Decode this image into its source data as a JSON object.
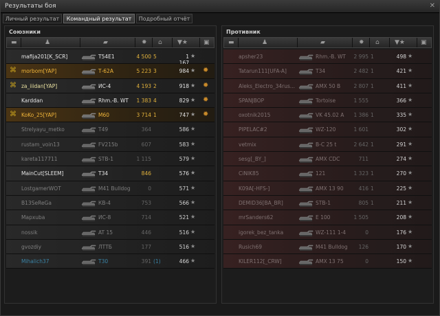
{
  "window": {
    "title": "Результаты боя",
    "close": "✕"
  },
  "tabs": [
    "Личный результат",
    "Командный результат",
    "Подробный отчёт"
  ],
  "allies": {
    "title": "Союзники",
    "rows": [
      {
        "player": "mafija201[K_SCR]",
        "tank": "T54E1",
        "dmg": "4 500",
        "kills": "5",
        "xp": "1 167",
        "alive": true,
        "medal": false,
        "ach": false
      },
      {
        "player": "morbom[YAP]",
        "tank": "Т-62А",
        "dmg": "5 223",
        "kills": "3",
        "xp": "984",
        "alive": true,
        "medal": true,
        "ach": true,
        "me": true
      },
      {
        "player": "za_iiidan[YAP]",
        "tank": "ИС-4",
        "dmg": "4 193",
        "kills": "2",
        "xp": "918",
        "alive": true,
        "medal": true,
        "ach": true,
        "platoon": true
      },
      {
        "player": "Karddan",
        "tank": "Rhm.-B. WT",
        "dmg": "1 383",
        "kills": "4",
        "xp": "829",
        "alive": true,
        "medal": false,
        "ach": true
      },
      {
        "player": "KoKo_25[YAP]",
        "tank": "M60",
        "dmg": "3 714",
        "kills": "1",
        "xp": "747",
        "alive": true,
        "medal": true,
        "ach": true,
        "me": true
      },
      {
        "player": "Strelyayu_metko",
        "tank": "T49",
        "dmg": "364",
        "kills": "",
        "xp": "586",
        "alive": false
      },
      {
        "player": "rustam_voin13",
        "tank": "FV215b",
        "dmg": "607",
        "kills": "",
        "xp": "583",
        "alive": false
      },
      {
        "player": "kareta117711",
        "tank": "STB-1",
        "dmg": "1 115",
        "kills": "",
        "xp": "579",
        "alive": false
      },
      {
        "player": "MainCut[SLEEM]",
        "tank": "T34",
        "dmg": "846",
        "kills": "",
        "xp": "576",
        "alive": true
      },
      {
        "player": "LostgamerWOT",
        "tank": "M41 Bulldog",
        "dmg": "0",
        "kills": "",
        "xp": "571",
        "alive": false
      },
      {
        "player": "B13SeReGa",
        "tank": "КВ-4",
        "dmg": "753",
        "kills": "",
        "xp": "566",
        "alive": false
      },
      {
        "player": "Марxuba",
        "tank": "ИС-8",
        "dmg": "714",
        "kills": "",
        "xp": "521",
        "alive": false
      },
      {
        "player": "nossik",
        "tank": "AT 15",
        "dmg": "446",
        "kills": "",
        "xp": "516",
        "alive": false
      },
      {
        "player": "gvozdiy",
        "tank": "ЛТТБ",
        "dmg": "177",
        "kills": "",
        "xp": "516",
        "alive": false
      },
      {
        "player": "Mihalich37",
        "tank": "T30",
        "dmg": "391",
        "kills": "(1)",
        "xp": "466",
        "alive": false,
        "blue": true
      }
    ]
  },
  "enemies": {
    "title": "Противник",
    "rows": [
      {
        "player": "apsher23",
        "tank": "Rhm.-B. WT",
        "dmg": "2 995",
        "kills": "1",
        "xp": "498"
      },
      {
        "player": "Tatarun111[UFA-A]",
        "tank": "T34",
        "dmg": "2 482",
        "kills": "1",
        "xp": "421"
      },
      {
        "player": "Aleks_Electro_34rus...",
        "tank": "AMX 50 B",
        "dmg": "2 807",
        "kills": "1",
        "xp": "411"
      },
      {
        "player": "SPANJBOP",
        "tank": "Tortoise",
        "dmg": "1 555",
        "kills": "",
        "xp": "366"
      },
      {
        "player": "oxotnik2015",
        "tank": "VK 45.02 A",
        "dmg": "1 386",
        "kills": "1",
        "xp": "335"
      },
      {
        "player": "PIPELAC#2",
        "tank": "WZ-120",
        "dmg": "1 601",
        "kills": "",
        "xp": "302"
      },
      {
        "player": "vetmix",
        "tank": "B-C 25 t",
        "dmg": "2 642",
        "kills": "1",
        "xp": "291"
      },
      {
        "player": "sesg[_BY_]",
        "tank": "AMX CDC",
        "dmg": "711",
        "kills": "",
        "xp": "274"
      },
      {
        "player": "CiNIK85",
        "tank": "121",
        "dmg": "1 323",
        "kills": "1",
        "xp": "270"
      },
      {
        "player": "K09A[-HFS-]",
        "tank": "AMX 13 90",
        "dmg": "416",
        "kills": "1",
        "xp": "225"
      },
      {
        "player": "DEMID36[BA_BR]",
        "tank": "STB-1",
        "dmg": "805",
        "kills": "1",
        "xp": "211"
      },
      {
        "player": "mrSanders62",
        "tank": "E 100",
        "dmg": "1 505",
        "kills": "",
        "xp": "208"
      },
      {
        "player": "igorek_bez_tanka",
        "tank": "WZ-111 1-4",
        "dmg": "0",
        "kills": "",
        "xp": "176"
      },
      {
        "player": "Rusich69",
        "tank": "M41 Bulldog",
        "dmg": "126",
        "kills": "",
        "xp": "170"
      },
      {
        "player": "KILER112[_CRW]",
        "tank": "AMX 13 75",
        "dmg": "0",
        "kills": "",
        "xp": "150"
      }
    ]
  },
  "icons": {
    "medal": "platoon-medal-icon",
    "star": "★",
    "achievement": "achievement-icon"
  }
}
